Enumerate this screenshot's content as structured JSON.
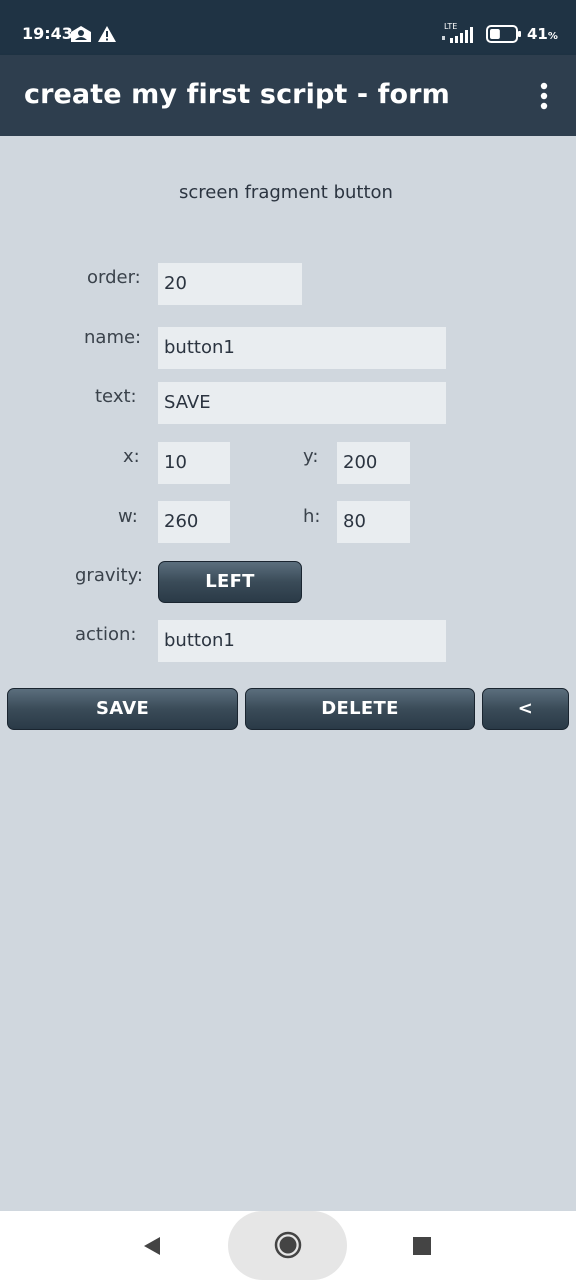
{
  "status_bar": {
    "time": "19:43",
    "network": "LTE",
    "battery_percent": "41",
    "battery_unit": "%",
    "battery_level": 0.41,
    "icons": [
      "message-notification-icon",
      "warning-icon",
      "signal-icon",
      "battery-icon"
    ]
  },
  "app_bar": {
    "title": "create my first script - form",
    "menu_icon": "more-vert-icon"
  },
  "form": {
    "heading": "screen fragment  button",
    "order_label": "order:",
    "order_value": "20",
    "name_label": "name:",
    "name_value": "button1",
    "text_label": "text:",
    "text_value": "SAVE",
    "x_label": "x:",
    "x_value": "10",
    "y_label": "y:",
    "y_value": "200",
    "w_label": "w:",
    "w_value": "260",
    "h_label": "h:",
    "h_value": "80",
    "gravity_label": "gravity:",
    "gravity_value": "LEFT",
    "action_label": "action:",
    "action_value": "button1"
  },
  "actions": {
    "save": "SAVE",
    "delete": "DELETE",
    "back": "<"
  },
  "nav_bar": {
    "icons": [
      "back-icon",
      "home-icon",
      "recents-icon"
    ]
  },
  "colors": {
    "status_bar": "#1f3344",
    "app_bar": "#2e3e4e",
    "background": "#d0d7de",
    "field": "#e9edf0",
    "button": "#3a4b58"
  }
}
